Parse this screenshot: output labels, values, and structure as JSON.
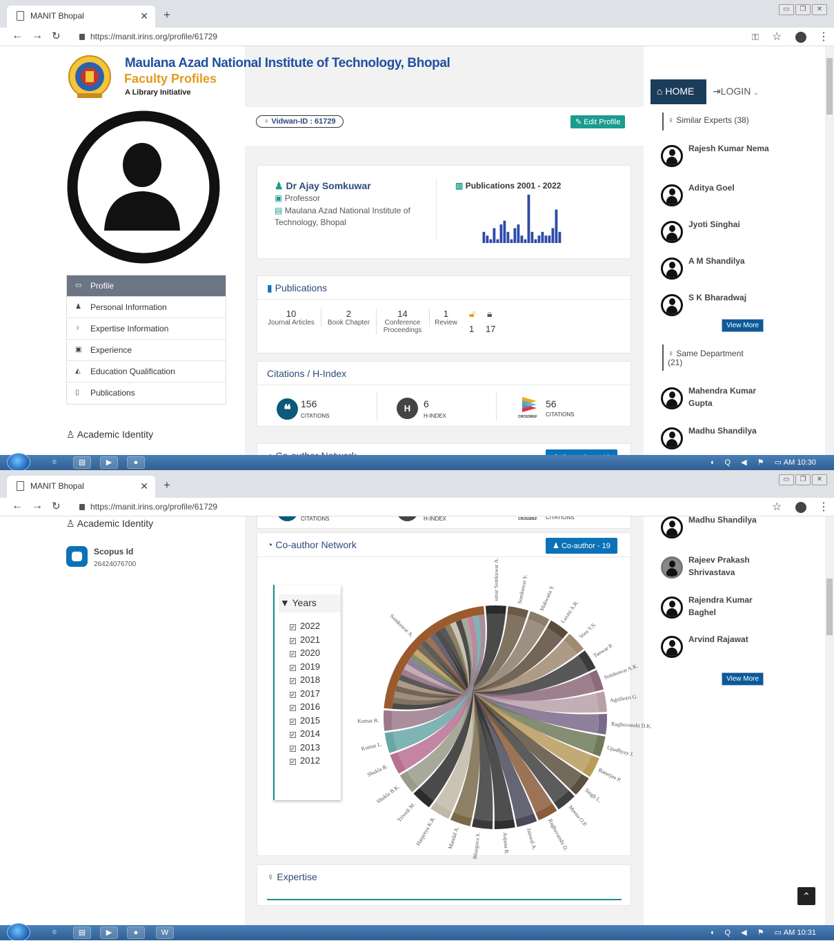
{
  "browser": {
    "tab_title": "MANIT Bhopal",
    "url": "https://manit.irins.org/profile/61729"
  },
  "taskbar": {
    "time1": "AM 10:30",
    "time2": "AM 10:31"
  },
  "header": {
    "institute": "Maulana Azad National Institute of Technology, Bhopal",
    "subtitle": "Faculty Profiles",
    "tagline": "A Library Initiative",
    "nav_home": "HOME",
    "nav_login": "LOGIN"
  },
  "profile": {
    "vidwan_id": "Vidwan-ID : 61729",
    "edit_label": "Edit Profile",
    "name": "Dr Ajay Somkuwar",
    "designation": "Professor",
    "affiliation": "Maulana Azad National Institute of Technology, Bhopal",
    "pub_title": "Publications 2001 - 2022",
    "pub_bars": [
      3,
      2,
      1,
      4,
      1,
      5,
      6,
      3,
      1,
      4,
      5,
      2,
      1,
      13,
      3,
      1,
      2,
      3,
      2,
      2,
      4,
      9,
      3
    ]
  },
  "menu": [
    {
      "label": "Profile",
      "icon": "monitor-icon"
    },
    {
      "label": "Personal Information",
      "icon": "user-icon"
    },
    {
      "label": "Expertise Information",
      "icon": "bulb-icon"
    },
    {
      "label": "Experience",
      "icon": "briefcase-icon"
    },
    {
      "label": "Education Qualification",
      "icon": "graduation-icon"
    },
    {
      "label": "Publications",
      "icon": "document-icon"
    }
  ],
  "academic_identity": {
    "title": "Academic Identity",
    "scopus_label": "Scopus Id",
    "scopus_value": "26424076700"
  },
  "publications": {
    "title": "Publications",
    "stats": [
      {
        "value": "10",
        "label1": "Journal Articles",
        "label2": ""
      },
      {
        "value": "2",
        "label1": "Book Chapter",
        "label2": ""
      },
      {
        "value": "14",
        "label1": "Conference",
        "label2": "Proceedings"
      },
      {
        "value": "1",
        "label1": "Review",
        "label2": ""
      }
    ],
    "open_access": "1",
    "closed_access": "17"
  },
  "citations": {
    "title": "Citations / H-Index",
    "scopus_citations": "156",
    "scopus_label": "CITATIONS",
    "h_index": "6",
    "h_label": "H-INDEX",
    "h_badge": "H",
    "crossref_citations": "56",
    "crossref_label": "CITATIONS",
    "crossref_logo": "CROSSREF"
  },
  "coauthor": {
    "title": "Co-author Network",
    "button": "Co-author - 19",
    "years_title": "Years",
    "years": [
      "2022",
      "2021",
      "2020",
      "2019",
      "2018",
      "2017",
      "2016",
      "2015",
      "2014",
      "2013",
      "2012"
    ],
    "names": [
      "umar Somkuwar A.",
      "Somkuwar Y.",
      "Makwana Y.",
      "Laxmi A.R.",
      "Vora V.S.",
      "Tanwar P.",
      "Somkuwar A.K.",
      "Agnihotri G.",
      "Raghuvanshi D.K.",
      "Upadhyay J.",
      "Banerjee P.",
      "Singh L.",
      "Meena O.P.",
      "Raghuvanshi D.",
      "Jaiswal A.",
      "Anjana R.",
      "Bhargava S.",
      "Mandal A.",
      "Harpreya K.R.",
      "Trivedi M.",
      "Shukla B.K.",
      "Shukla R.",
      "Kumar L.",
      "Kumar R.",
      "Somkuwar A."
    ]
  },
  "expertise": {
    "title": "Expertise"
  },
  "similar_experts": {
    "title": "Similar Experts (38)",
    "items": [
      "Rajesh Kumar Nema",
      "Aditya Goel",
      "Jyoti Singhai",
      "A M Shandilya",
      "S K Bharadwaj"
    ],
    "view_more": "View More"
  },
  "same_department": {
    "title": "Same Department",
    "count": "(21)",
    "items": [
      "Mahendra Kumar Gupta",
      "Madhu Shandilya"
    ],
    "items2": [
      "Madhu Shandilya",
      "Rajeev Prakash Shrivastava",
      "Rajendra Kumar Baghel",
      "Arvind Rajawat"
    ],
    "view_more": "View More"
  },
  "colors": {
    "accent": "#0b72b8",
    "nav_dark": "#1c3d5a",
    "chord_main": "#9b5a2e"
  }
}
